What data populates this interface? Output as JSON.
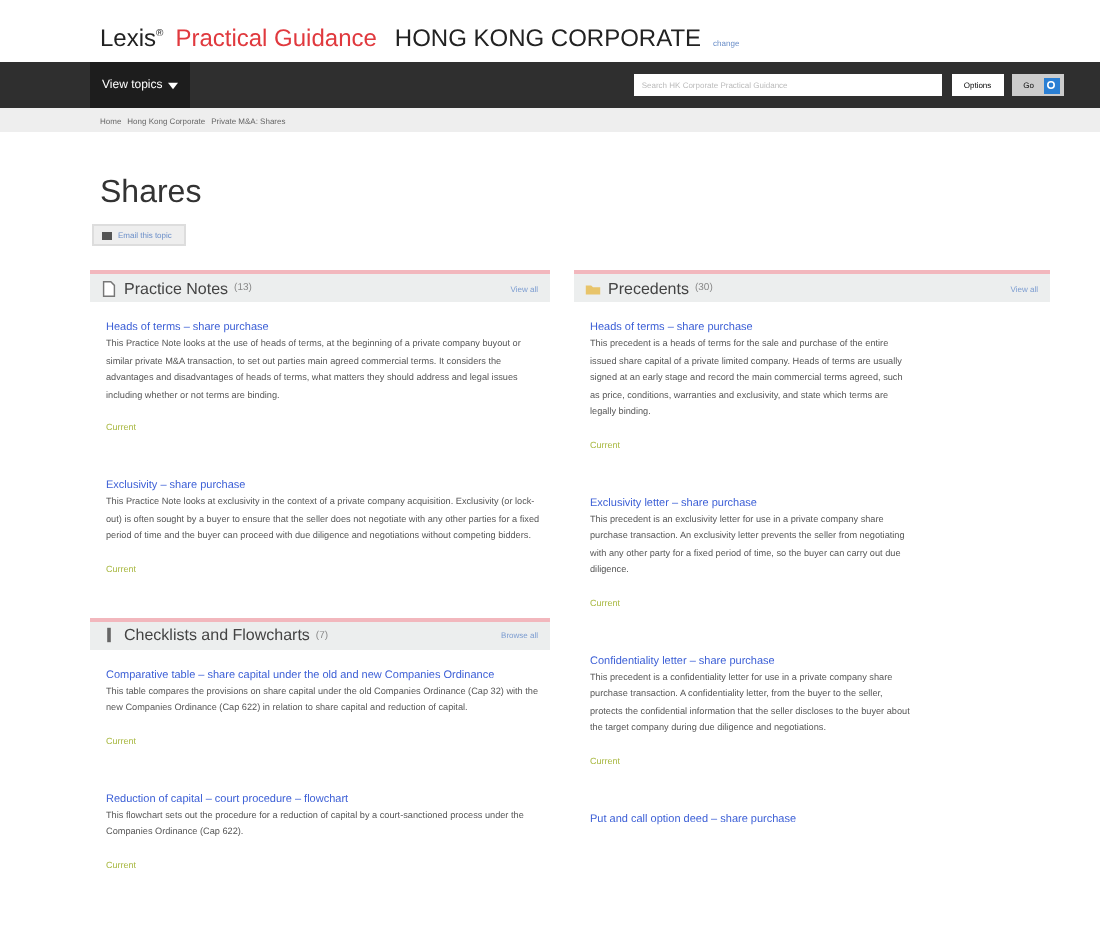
{
  "header": {
    "brand": "Lexis$^{®}$",
    "product": "Practical Guidance",
    "module": "HONG KONG CORPORATE",
    "change_link": "change"
  },
  "nav": {
    "menu": "View topics",
    "search": {
      "placeholder": "Search HK Corporate Practical Guidance"
    },
    "options_button": "Options",
    "go_button": "Go"
  },
  "breadcrumb": [
    "Home",
    "Hong Kong Corporate",
    "Private M&A: Shares"
  ],
  "page_title": "Shares",
  "action_button": "Email this topic",
  "columns": [
    [
      {
        "kind": "notes",
        "title": "Practice Notes",
        "count": "(13)",
        "link": "View all",
        "items": [
          {
            "title": "Heads of terms – share purchase",
            "body": "This Practice Note looks at the use of heads of terms, at the beginning of a private company buyout or similar private M&A transaction, to set out parties main agreed commercial terms. It considers the advantages and disadvantages of heads of terms, what matters they should address and legal issues including whether or not terms are binding.",
            "status": "Current"
          },
          {
            "title": "Exclusivity – share purchase",
            "body": "This Practice Note looks at exclusivity in the context of a private company acquisition. Exclusivity (or lock-out) is often sought by a buyer to ensure that the seller does not negotiate with any other parties for a fixed period of time and the buyer can proceed with due diligence and negotiations without competing bidders.",
            "status": "Current"
          }
        ]
      },
      {
        "kind": "checklists",
        "title": "Checklists and Flowcharts",
        "count": "(7)",
        "link": "Browse all",
        "items": [
          {
            "title": "Comparative table – share capital under the old and new Companies Ordinance",
            "body": "This table compares the provisions on share capital under the old Companies Ordinance (Cap 32) with the new Companies Ordinance (Cap 622) in relation to share capital and reduction of capital.",
            "status": "Current"
          },
          {
            "title": "Reduction of capital – court procedure – flowchart",
            "body": "This flowchart sets out the procedure for a reduction of capital by a court-sanctioned process under the Companies Ordinance (Cap 622).",
            "status": "Current"
          }
        ]
      }
    ],
    [
      {
        "kind": "precedents",
        "title": "Precedents",
        "count": "(30)",
        "link": "View all",
        "items": [
          {
            "title": "Heads of terms – share purchase",
            "body": "This precedent is a heads of terms for the sale and purchase of the entire issued share capital of a private limited company. Heads of terms are usually signed at an early stage and record the main commercial terms agreed, such as price, conditions, warranties and exclusivity, and state which terms are legally binding.",
            "status": "Current"
          },
          {
            "title": "Exclusivity letter – share purchase",
            "body": "This precedent is an exclusivity letter for use in a private company share purchase transaction. An exclusivity letter prevents the seller from negotiating with any other party for a fixed period of time, so the buyer can carry out due diligence.",
            "status": "Current"
          },
          {
            "title": "Confidentiality letter – share purchase",
            "body": "This precedent is a confidentiality letter for use in a private company share purchase transaction. A confidentiality letter, from the buyer to the seller, protects the confidential information that the seller discloses to the buyer about the target company during due diligence and negotiations.",
            "status": "Current"
          },
          {
            "title": "Put and call option deed – share purchase"
          }
        ]
      }
    ]
  ]
}
